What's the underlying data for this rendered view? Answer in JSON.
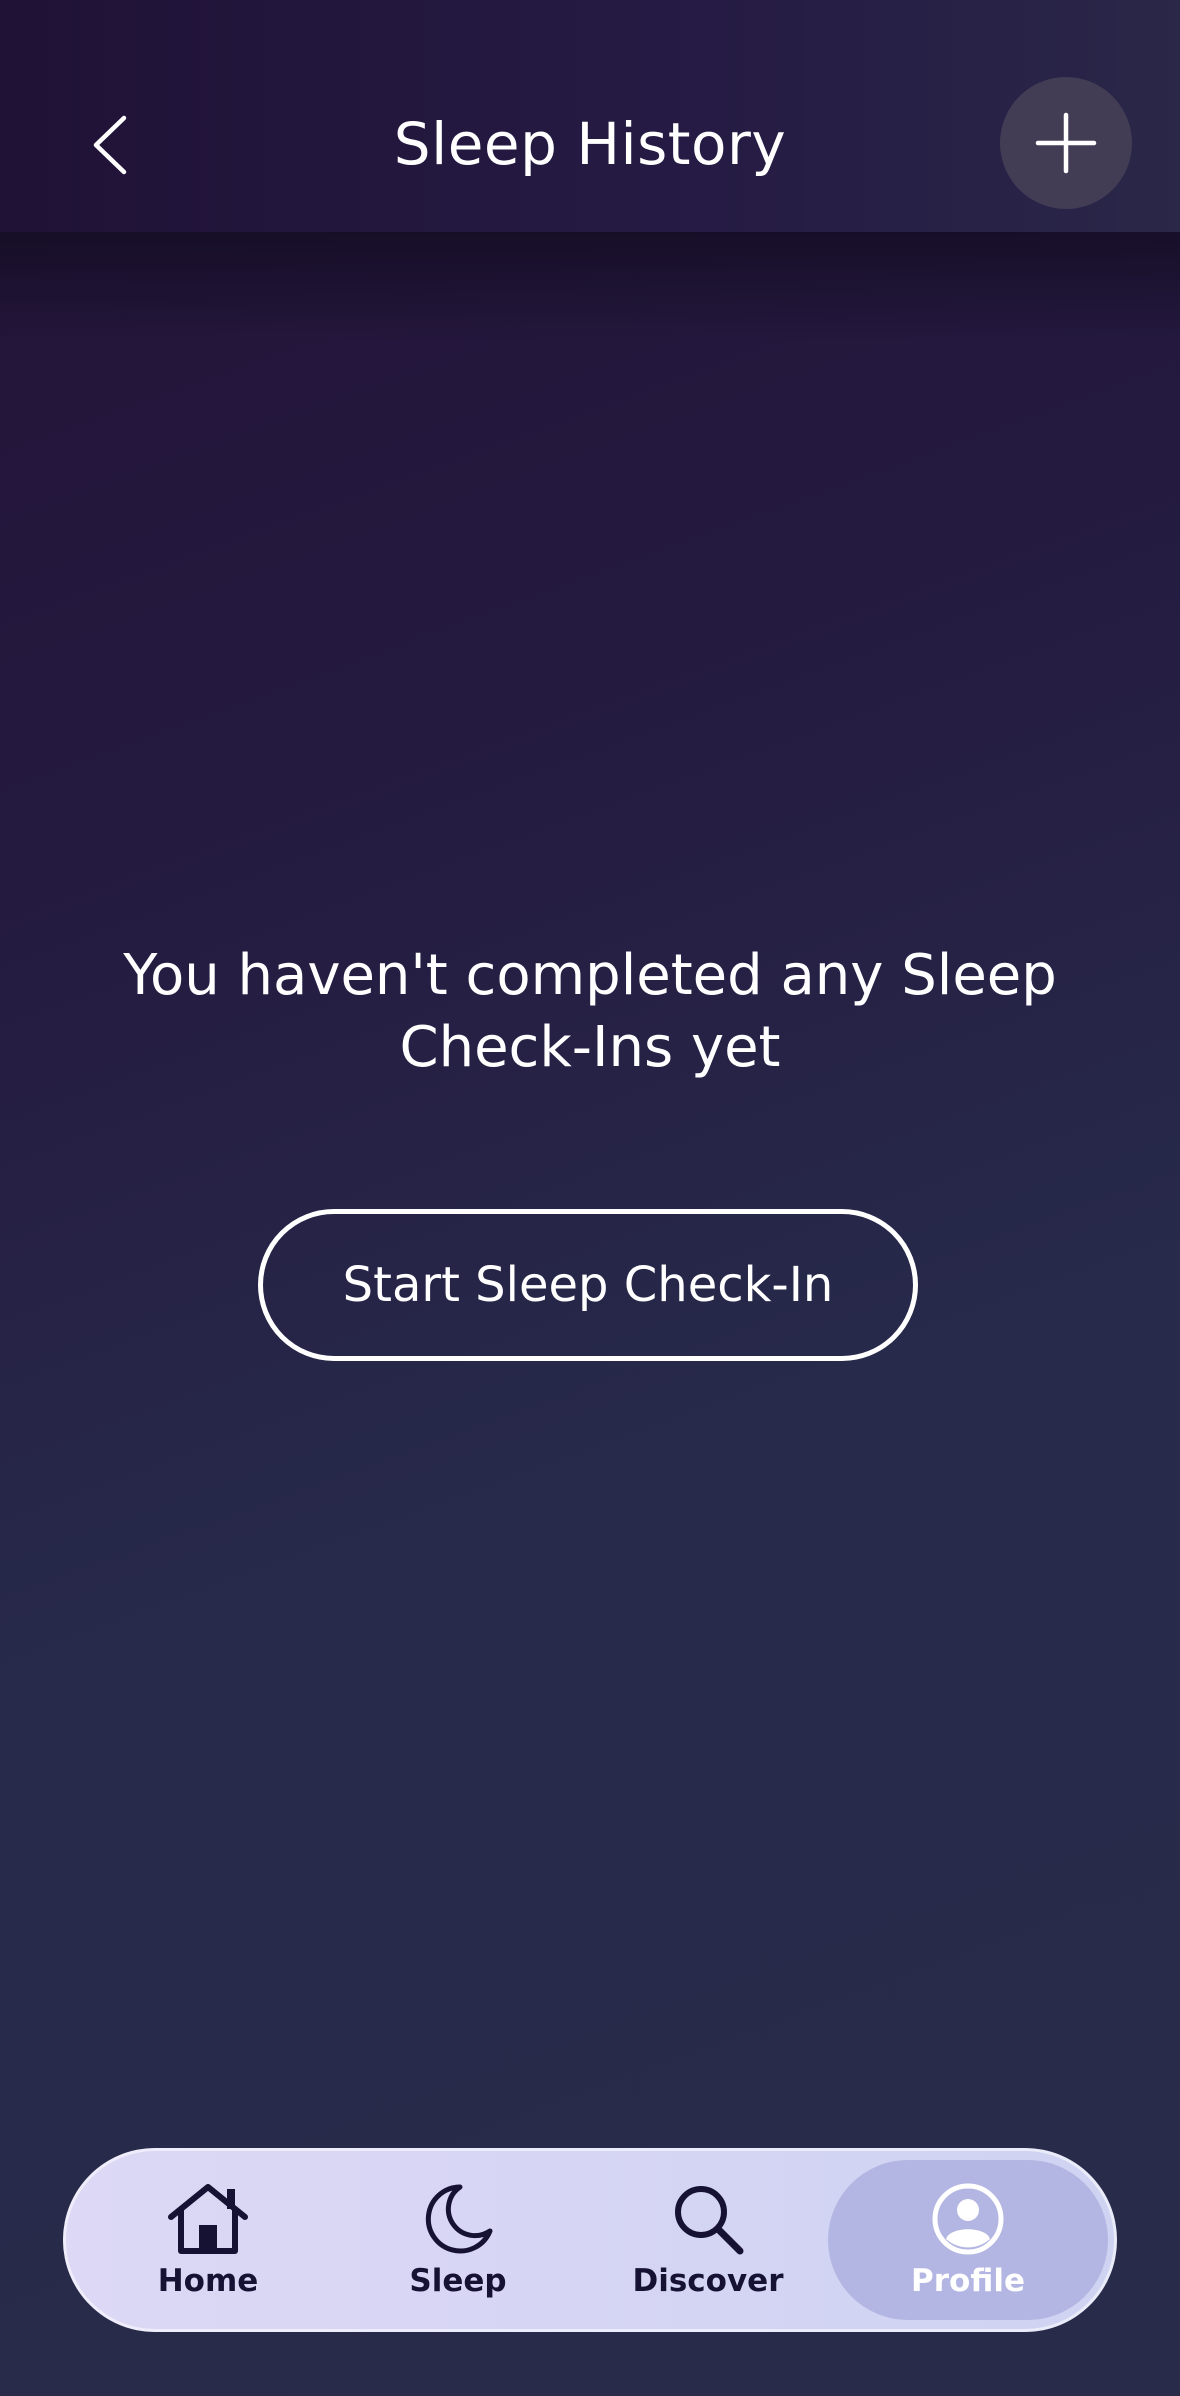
{
  "header": {
    "title": "Sleep History",
    "back_icon": "chevron-left-icon",
    "add_icon": "plus-icon"
  },
  "main": {
    "empty_message": "You haven't completed any Sleep Check-Ins yet",
    "start_button_label": "Start Sleep Check-In"
  },
  "nav": {
    "items": [
      {
        "label": "Home",
        "icon": "home-icon"
      },
      {
        "label": "Sleep",
        "icon": "moon-icon"
      },
      {
        "label": "Discover",
        "icon": "search-icon"
      },
      {
        "label": "Profile",
        "icon": "profile-icon",
        "active": true
      }
    ]
  },
  "colors": {
    "nav_background": "#d6d6f4",
    "nav_active": "#b3b6e2",
    "nav_icon": "#161233",
    "accent": "#ffffff"
  }
}
